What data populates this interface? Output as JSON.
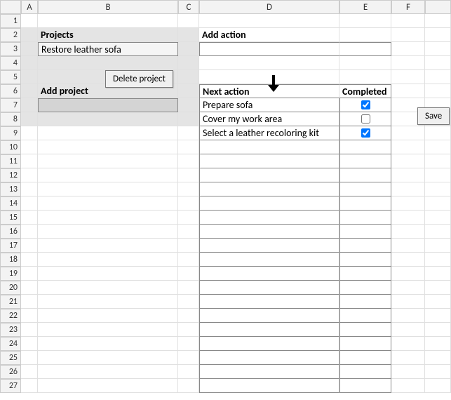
{
  "columns": [
    "A",
    "B",
    "C",
    "D",
    "E",
    "F"
  ],
  "rowCount": 27,
  "labels": {
    "projects": "Projects",
    "addProject": "Add project",
    "addAction": "Add action",
    "nextAction": "Next action",
    "completed": "Completed"
  },
  "projects": {
    "items": [
      "Restore leather sofa"
    ],
    "inputValue": ""
  },
  "actions": {
    "inputValue": "",
    "items": [
      {
        "text": "Prepare sofa",
        "completed": true
      },
      {
        "text": "Cover my work area",
        "completed": false
      },
      {
        "text": "Select a leather recoloring kit",
        "completed": true
      }
    ]
  },
  "buttons": {
    "deleteProject": "Delete project",
    "save": "Save"
  },
  "icons": {
    "arrowDown": "down-arrow-icon"
  }
}
